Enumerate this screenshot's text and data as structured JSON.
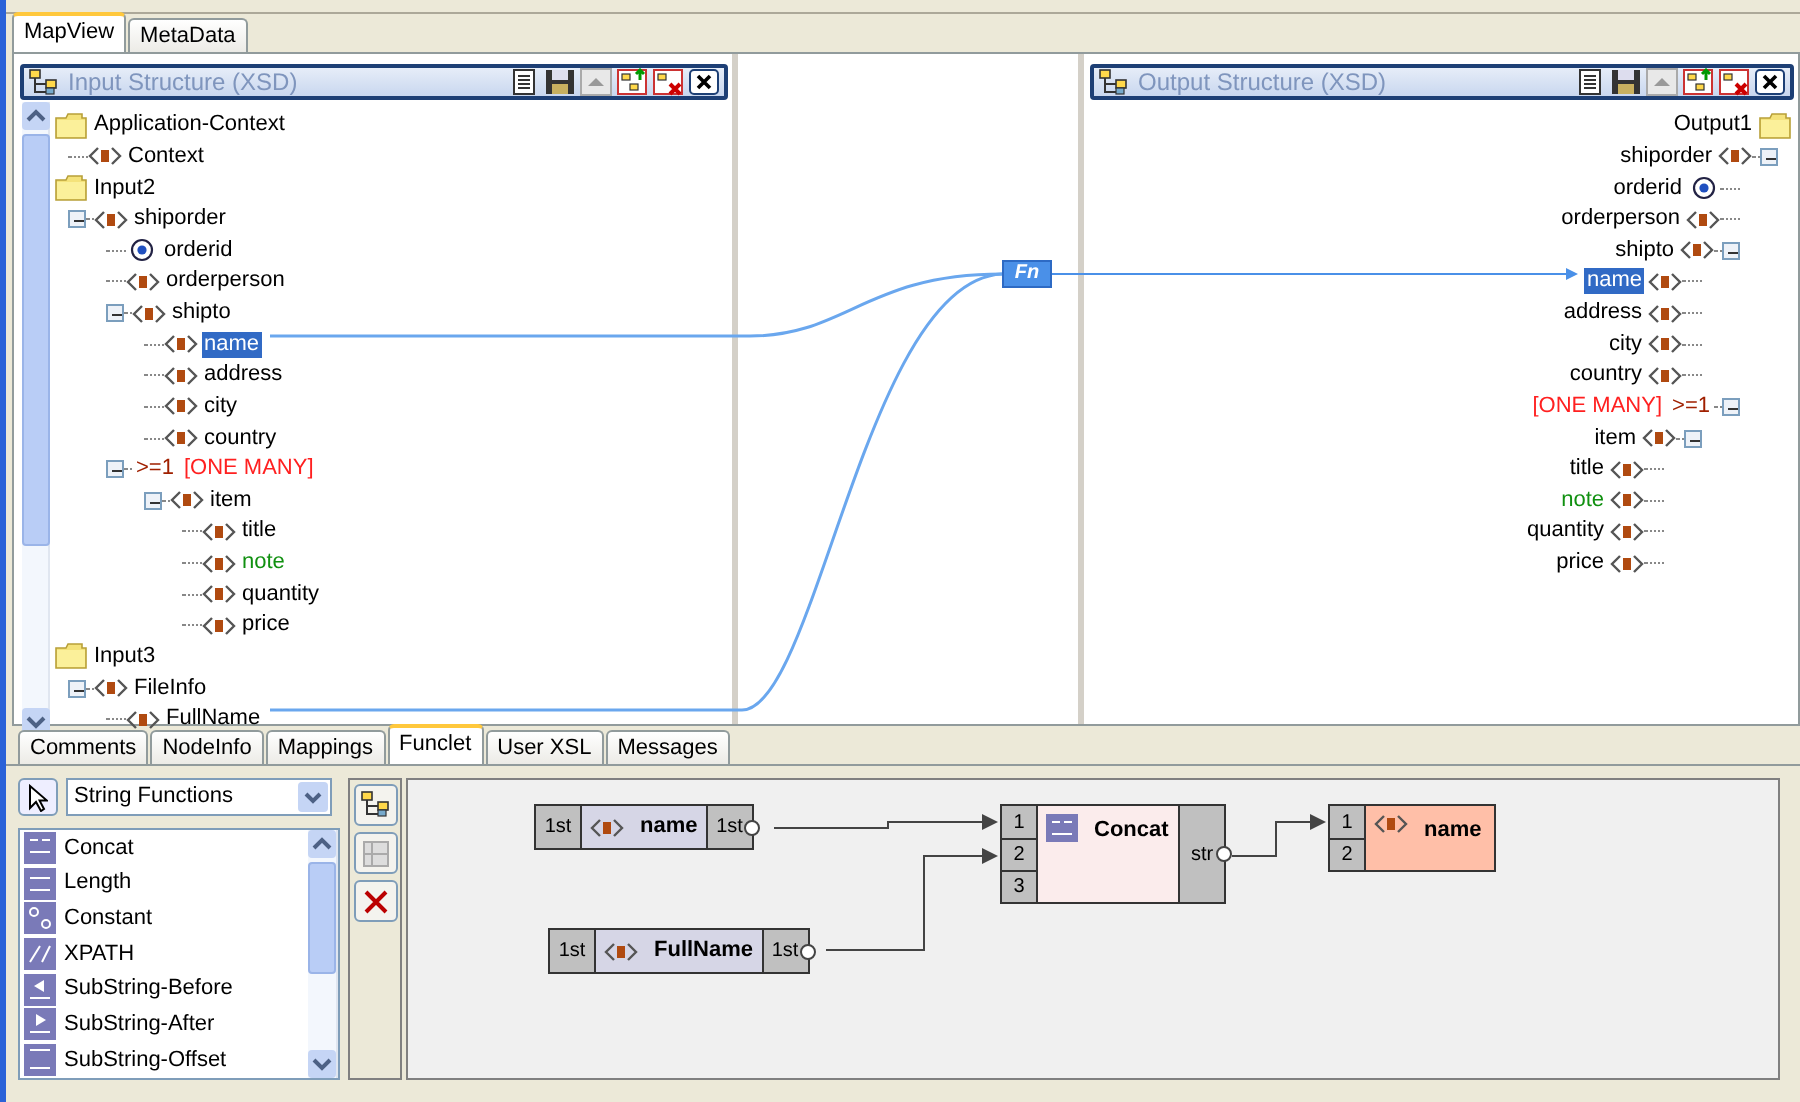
{
  "tabs": [
    {
      "label": "MapView",
      "selected": true
    },
    {
      "label": "MetaData",
      "selected": false
    }
  ],
  "input_panel": {
    "title": "Input Structure (XSD)",
    "tree": [
      {
        "kind": "folder",
        "label": "Application-Context",
        "selected": false,
        "children": [
          {
            "kind": "element",
            "label": "Context",
            "selected": false
          }
        ]
      },
      {
        "kind": "folder",
        "label": "Input2",
        "selected": false,
        "children": [
          {
            "kind": "element",
            "label": "shiporder",
            "selected": false,
            "expanded": true,
            "children": [
              {
                "kind": "attribute",
                "label": "orderid",
                "selected": false
              },
              {
                "kind": "element",
                "label": "orderperson",
                "selected": false
              },
              {
                "kind": "element",
                "label": "shipto",
                "selected": false,
                "expanded": true,
                "children": [
                  {
                    "kind": "element",
                    "label": "name",
                    "selected": true
                  },
                  {
                    "kind": "element",
                    "label": "address",
                    "selected": false
                  },
                  {
                    "kind": "element",
                    "label": "city",
                    "selected": false
                  },
                  {
                    "kind": "element",
                    "label": "country",
                    "selected": false
                  }
                ]
              },
              {
                "kind": "group",
                "cardinality": ">=1",
                "label": "[ONE MANY]",
                "color": "#ff2020",
                "selected": false,
                "expanded": true,
                "children": [
                  {
                    "kind": "element",
                    "label": "item",
                    "selected": false,
                    "expanded": true,
                    "children": [
                      {
                        "kind": "element",
                        "label": "title",
                        "selected": false
                      },
                      {
                        "kind": "element",
                        "label": "note",
                        "color": "#109010",
                        "selected": false
                      },
                      {
                        "kind": "element",
                        "label": "quantity",
                        "selected": false
                      },
                      {
                        "kind": "element",
                        "label": "price",
                        "selected": false
                      }
                    ]
                  }
                ]
              }
            ]
          }
        ]
      },
      {
        "kind": "folder",
        "label": "Input3",
        "selected": false,
        "children": [
          {
            "kind": "element",
            "label": "FileInfo",
            "selected": false,
            "expanded": true,
            "children": [
              {
                "kind": "element",
                "label": "FullName",
                "selected": false
              }
            ]
          }
        ]
      }
    ]
  },
  "mapping": {
    "function_label": "Fn"
  },
  "output_panel": {
    "title": "Output Structure (XSD)",
    "tree": [
      {
        "kind": "folder",
        "label": "Output1",
        "selected": false,
        "children": [
          {
            "kind": "element",
            "label": "shiporder",
            "selected": false,
            "expanded": true,
            "children": [
              {
                "kind": "attribute",
                "label": "orderid",
                "selected": false
              },
              {
                "kind": "element",
                "label": "orderperson",
                "selected": false
              },
              {
                "kind": "element",
                "label": "shipto",
                "selected": false,
                "expanded": true,
                "children": [
                  {
                    "kind": "element",
                    "label": "name",
                    "selected": true
                  },
                  {
                    "kind": "element",
                    "label": "address",
                    "selected": false
                  },
                  {
                    "kind": "element",
                    "label": "city",
                    "selected": false
                  },
                  {
                    "kind": "element",
                    "label": "country",
                    "selected": false
                  }
                ]
              },
              {
                "kind": "group",
                "cardinality": ">=1",
                "label": "[ONE MANY]",
                "color": "#ff2020",
                "selected": false,
                "expanded": true,
                "children": [
                  {
                    "kind": "element",
                    "label": "item",
                    "selected": false,
                    "expanded": true,
                    "children": [
                      {
                        "kind": "element",
                        "label": "title",
                        "selected": false
                      },
                      {
                        "kind": "element",
                        "label": "note",
                        "color": "#109010",
                        "selected": false
                      },
                      {
                        "kind": "element",
                        "label": "quantity",
                        "selected": false
                      },
                      {
                        "kind": "element",
                        "label": "price",
                        "selected": false
                      }
                    ]
                  }
                ]
              }
            ]
          }
        ]
      }
    ]
  },
  "bottom_tabs": [
    {
      "label": "Comments",
      "selected": false
    },
    {
      "label": "NodeInfo",
      "selected": false
    },
    {
      "label": "Mappings",
      "selected": false
    },
    {
      "label": "Funclet",
      "selected": true
    },
    {
      "label": "User XSL",
      "selected": false
    },
    {
      "label": "Messages",
      "selected": false
    }
  ],
  "funclet": {
    "category": "String Functions",
    "functions": [
      {
        "label": "Concat"
      },
      {
        "label": "Length"
      },
      {
        "label": "Constant"
      },
      {
        "label": "XPATH"
      },
      {
        "label": "SubString-Before"
      },
      {
        "label": "SubString-After"
      },
      {
        "label": "SubString-Offset"
      }
    ],
    "nodes": [
      {
        "kind": "source",
        "label": "name",
        "in_port": "1st",
        "out_port": "1st"
      },
      {
        "kind": "source",
        "label": "FullName",
        "in_port": "1st",
        "out_port": "1st"
      },
      {
        "kind": "function",
        "label": "Concat",
        "inputs": [
          "1",
          "2",
          "3"
        ],
        "output": "str"
      },
      {
        "kind": "target",
        "label": "name",
        "inputs": [
          "1",
          "2"
        ]
      }
    ]
  }
}
